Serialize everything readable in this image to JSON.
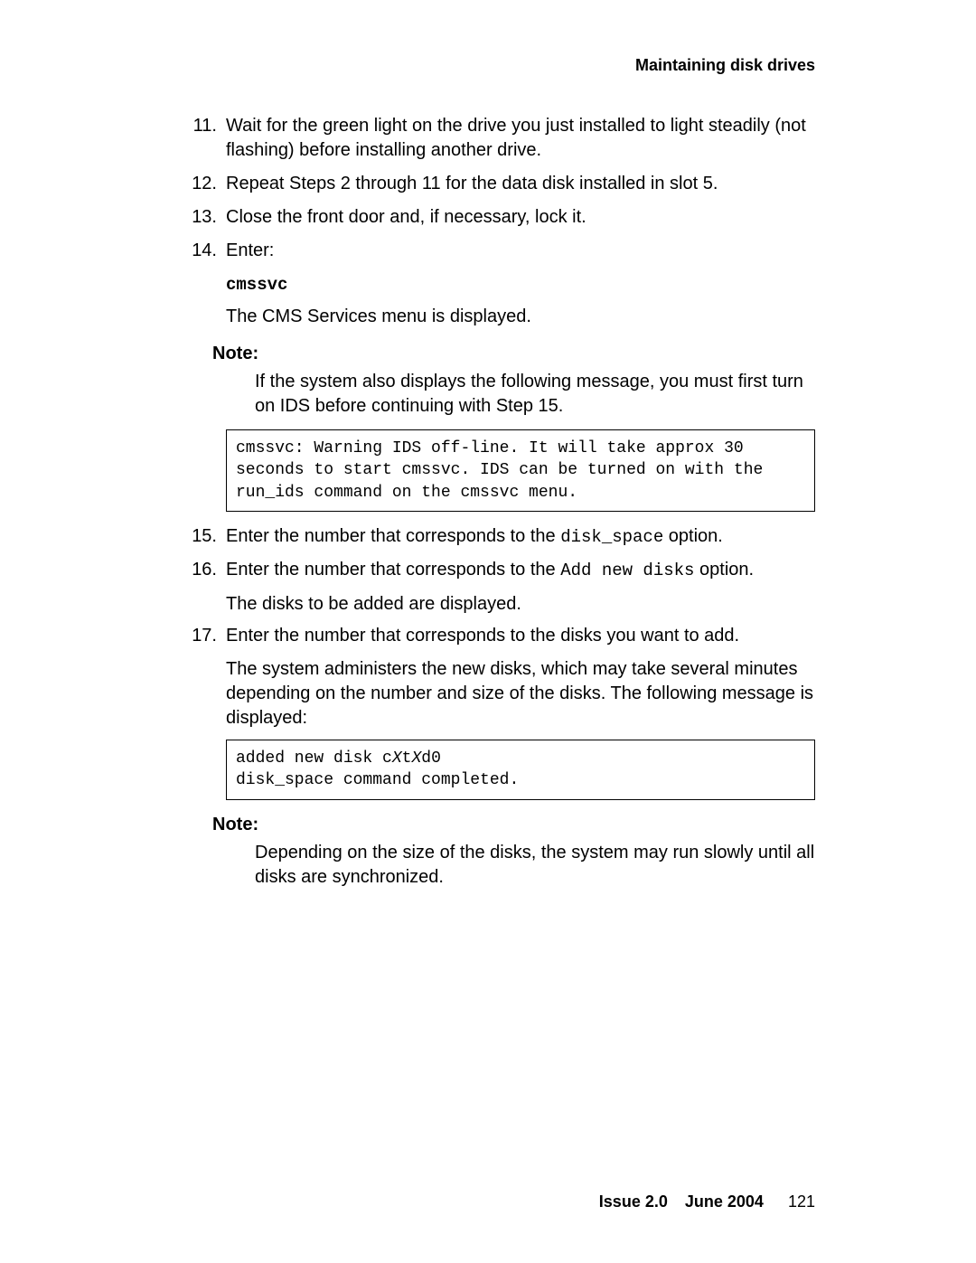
{
  "header": {
    "title": "Maintaining disk drives"
  },
  "steps": {
    "s11": {
      "num": "11.",
      "text": "Wait for the green light on the drive you just installed to light steadily (not flashing) before installing another drive."
    },
    "s12": {
      "num": "12.",
      "text": "Repeat Steps 2 through 11 for the data disk installed in slot 5."
    },
    "s13": {
      "num": "13.",
      "text": "Close the front door and, if necessary, lock it."
    },
    "s14": {
      "num": "14.",
      "text": "Enter:",
      "command": "cmssvc",
      "after": "The CMS Services menu is displayed.",
      "note_label": "Note:",
      "note_body": "If the system also displays the following message, you must first turn on IDS before continuing with Step 15.",
      "code": "cmssvc: Warning IDS off-line. It will take approx 30 seconds to start cmssvc. IDS can be turned on with the run_ids command on the cmssvc menu."
    },
    "s15": {
      "num": "15.",
      "pre": "Enter the number that corresponds to the ",
      "code_inline": "disk_space",
      "post": " option."
    },
    "s16": {
      "num": "16.",
      "pre": "Enter the number that corresponds to the ",
      "code_inline": "Add new disks",
      "post": " option.",
      "after": "The disks to be added are displayed."
    },
    "s17": {
      "num": "17.",
      "text": "Enter the number that corresponds to the disks you want to add.",
      "after": "The system administers the new disks, which may take several minutes depending on the number and size of the disks. The following message is displayed:",
      "code_pre": "added new disk c",
      "code_x1": "X",
      "code_mid": "t",
      "code_x2": "X",
      "code_post": "d0\ndisk_space command completed.",
      "note_label": "Note:",
      "note_body": "Depending on the size of the disks, the system may run slowly until all disks are synchronized."
    }
  },
  "footer": {
    "issue": "Issue 2.0",
    "date": "June 2004",
    "page": "121"
  }
}
